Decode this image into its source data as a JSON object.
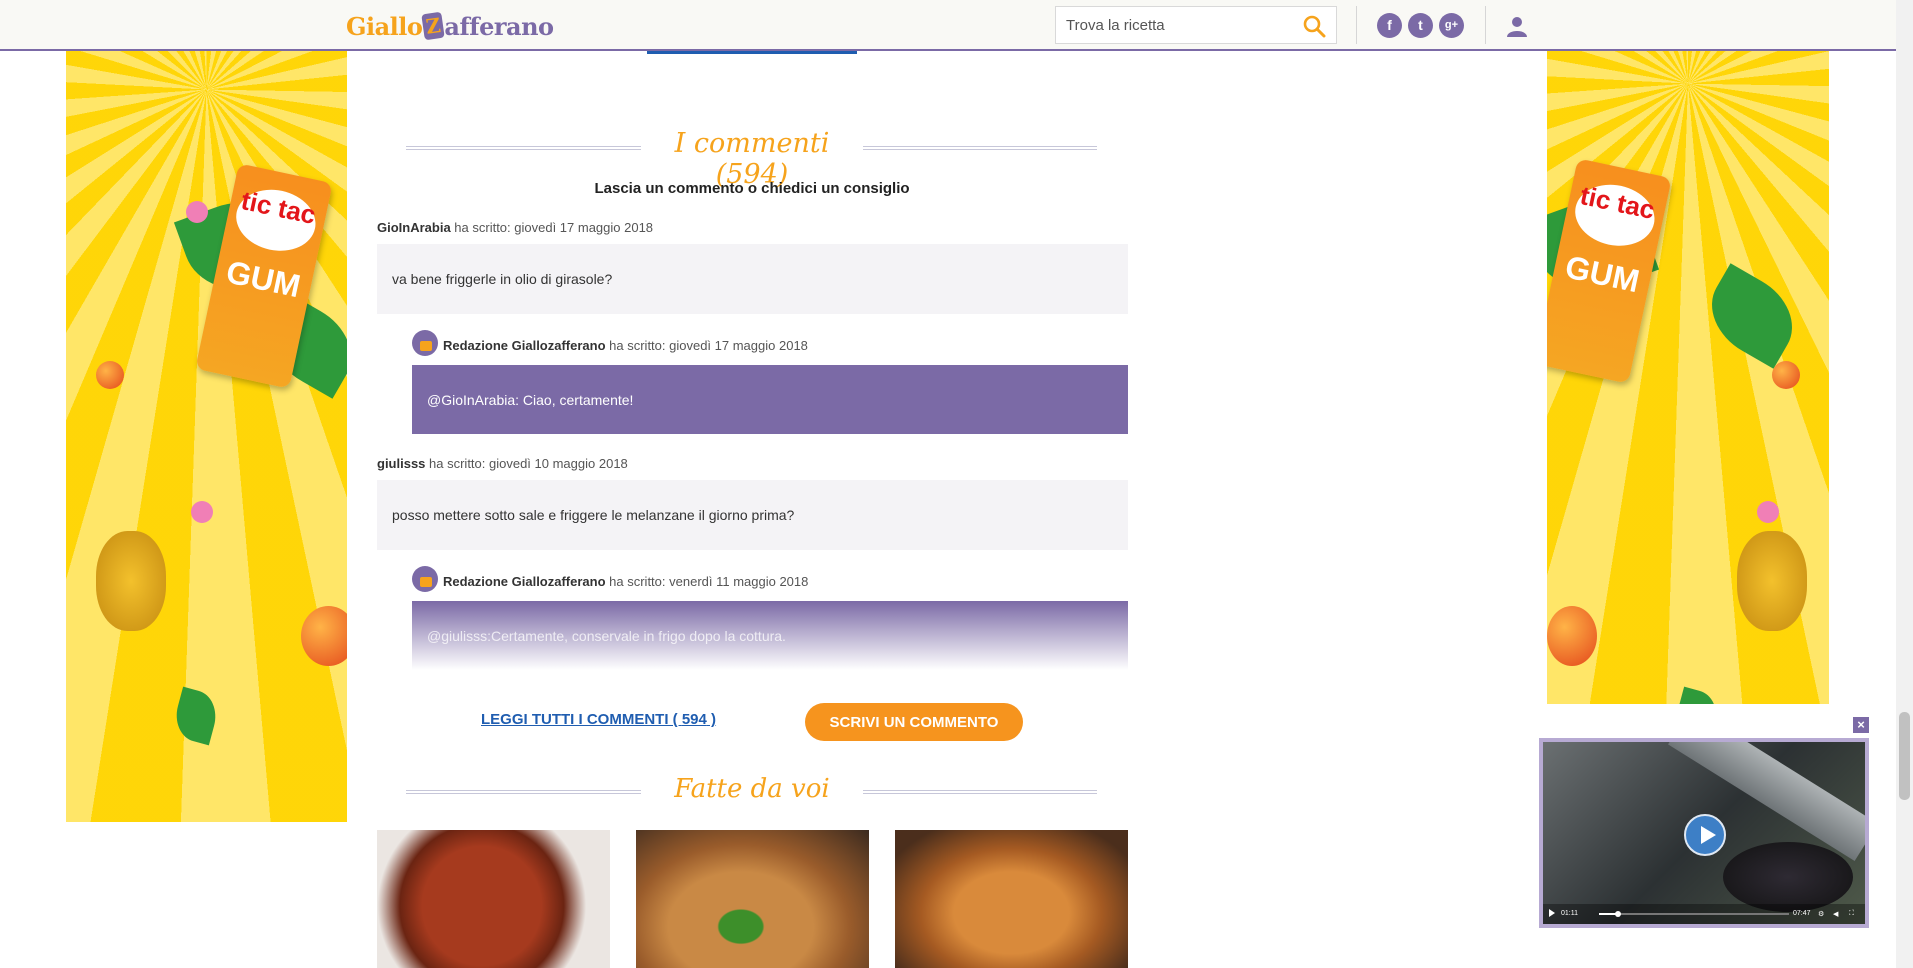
{
  "header": {
    "logo": {
      "part1": "Giallo",
      "badge": "Z",
      "part2": "afferano"
    },
    "search_placeholder": "Trova la ricetta",
    "social": [
      {
        "name": "facebook",
        "glyph": "f"
      },
      {
        "name": "twitter",
        "glyph": "t"
      },
      {
        "name": "google-plus",
        "glyph": "g+"
      }
    ]
  },
  "ad": {
    "brand": "tic tac",
    "product": "GUM"
  },
  "comments": {
    "title": "I commenti (594)",
    "subtitle": "Lascia un commento o chiedici un consiglio",
    "items": [
      {
        "author": "GioInArabia",
        "meta": " ha scritto: giovedì 17 maggio 2018",
        "text": "va bene friggerle in olio di girasole?",
        "reply": {
          "author": "Redazione Giallozafferano",
          "meta": " ha scritto: giovedì 17 maggio 2018",
          "text": "@GioInArabia: Ciao, certamente!"
        }
      },
      {
        "author": "giulisss",
        "meta": " ha scritto: giovedì 10 maggio 2018",
        "text": "posso mettere sotto sale e friggere le melanzane il giorno prima?",
        "reply": {
          "author": "Redazione Giallozafferano",
          "meta": " ha scritto: venerdì 11 maggio 2018",
          "text": "@giulisss:Certamente, conservale in frigo dopo la cottura."
        }
      }
    ],
    "read_all_label": "LEGGI TUTTI I COMMENTI ( ",
    "read_all_count": "594",
    "read_all_suffix": " )",
    "write_label": "SCRIVI UN COMMENTO"
  },
  "fatte": {
    "title": "Fatte da voi"
  },
  "video": {
    "time_current": "01:11",
    "time_total": "07:47",
    "progress": 0.1
  },
  "colors": {
    "purple": "#7b6aa6",
    "orange": "#f6a31c",
    "button_orange": "#f6941e",
    "link_blue": "#1f5db0"
  }
}
